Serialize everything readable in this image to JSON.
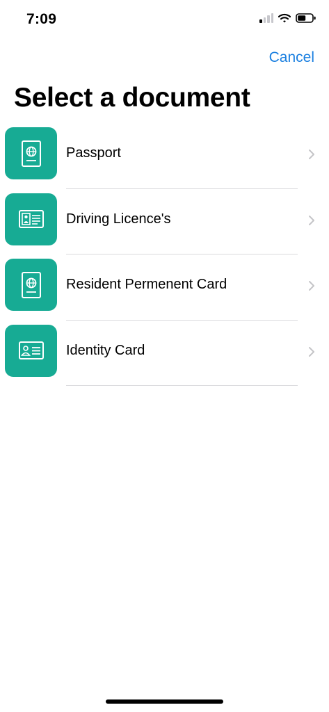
{
  "status_bar": {
    "time": "7:09",
    "icons": [
      "cellular-signal-icon",
      "wifi-icon",
      "battery-icon"
    ]
  },
  "nav": {
    "cancel_label": "Cancel"
  },
  "title": "Select a document",
  "documents": [
    {
      "label": "Passport",
      "icon": "passport-icon"
    },
    {
      "label": "Driving Licence's",
      "icon": "driving-licence-icon"
    },
    {
      "label": "Resident Permenent Card",
      "icon": "passport-icon"
    },
    {
      "label": "Identity Card",
      "icon": "identity-card-icon"
    }
  ],
  "colors": {
    "accent": "#17ab94",
    "link": "#1a7fe0",
    "chevron": "#c4c4c7",
    "divider": "#d9d9dc"
  }
}
